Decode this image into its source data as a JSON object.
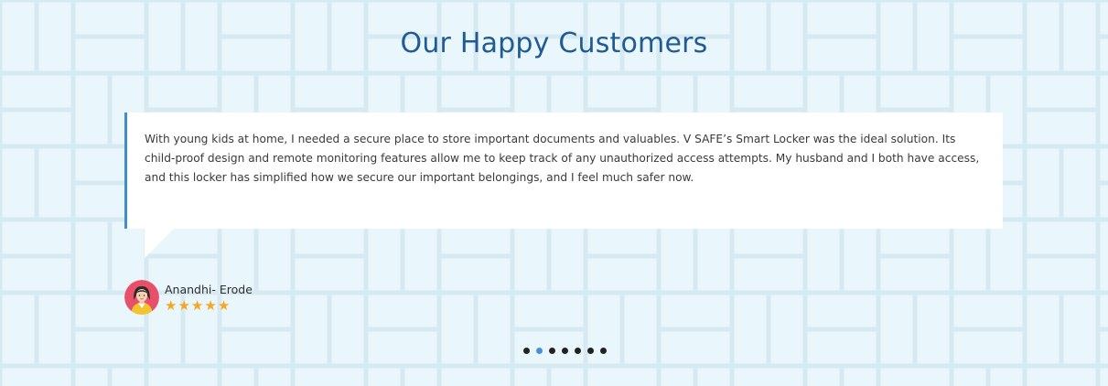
{
  "section": {
    "title": "Our Happy Customers"
  },
  "testimonial": {
    "quote": "With young kids at home, I needed a secure place to store important documents and valuables. V SAFE’s Smart Locker was the ideal solution. Its child-proof design and remote monitoring features allow me to keep track of any unauthorized access attempts. My husband and I both have access, and this locker has simplified how we secure our important belongings, and I feel much safer now.",
    "author": "Anandhi- Erode",
    "avatar_icon": "woman-avatar-icon",
    "rating": 5,
    "stars": [
      "★",
      "★",
      "★",
      "★",
      "★"
    ]
  },
  "pagination": {
    "total": 7,
    "active_index": 1
  },
  "colors": {
    "background": "#e9f6fb",
    "title": "#1f5b94",
    "accent": "#3f8ed0",
    "star": "#f5a623",
    "dot": "#222222",
    "dot_active": "#4a90d9"
  }
}
